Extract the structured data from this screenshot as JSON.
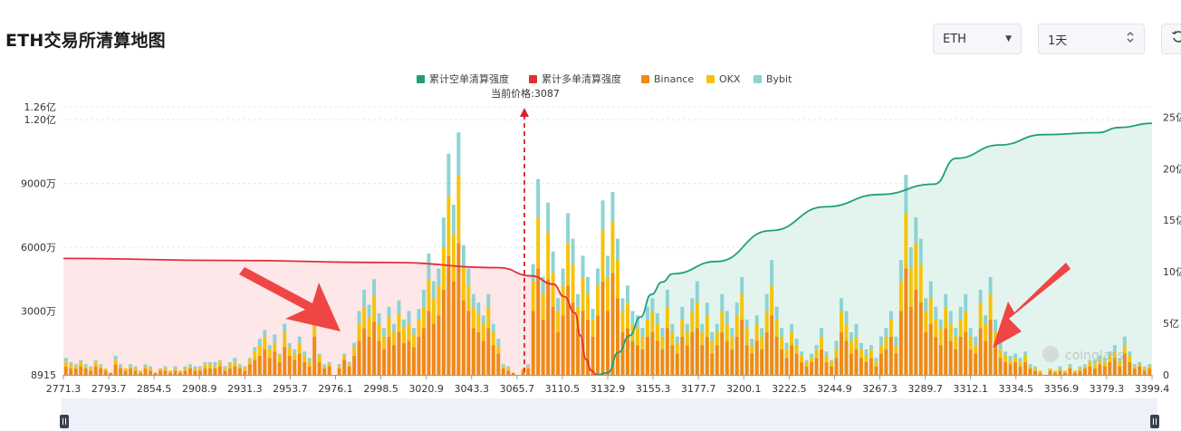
{
  "title": "ETH交易所清算地图",
  "controls": {
    "symbol": "ETH",
    "period": "1天"
  },
  "watermark": "coinglass",
  "chart_data": {
    "type": "bar",
    "title": "ETH交易所清算地图",
    "current_price_label": "当前价格:3087",
    "current_price": 3087,
    "legend": [
      {
        "name": "累计空单清算强度",
        "color": "#1f9e7f"
      },
      {
        "name": "累计多单清算强度",
        "color": "#e0303a"
      },
      {
        "name": "Binance",
        "color": "#ef8a17"
      },
      {
        "name": "OKX",
        "color": "#f5c30b"
      },
      {
        "name": "Bybit",
        "color": "#8dd3d4"
      }
    ],
    "legend_position": "top-center",
    "x_tick_labels": [
      "2771.3",
      "2793.7",
      "2854.5",
      "2908.9",
      "2931.3",
      "2953.7",
      "2976.1",
      "2998.5",
      "3020.9",
      "3043.3",
      "3065.7",
      "3110.5",
      "3132.9",
      "3155.3",
      "3177.7",
      "3200.1",
      "3222.5",
      "3244.9",
      "3267.3",
      "3289.7",
      "3312.1",
      "3334.5",
      "3356.9",
      "3379.3",
      "3399.4"
    ],
    "y_left_tick_labels": [
      "8915",
      "3000万",
      "6000万",
      "9000万",
      "1.20亿",
      "1.26亿"
    ],
    "y_left_ticks": [
      0,
      30000000,
      60000000,
      90000000,
      120000000,
      126000000
    ],
    "y_left_range": [
      0,
      126000000
    ],
    "y_right_tick_labels": [
      "0",
      "5亿",
      "10亿",
      "15亿",
      "20亿",
      "25亿"
    ],
    "y_right_ticks": [
      0,
      500000000,
      1000000000,
      1500000000,
      2000000000,
      2500000000
    ],
    "y_right_range": [
      0,
      2600000000
    ],
    "grid": true,
    "bar_stack": [
      [
        4,
        2,
        2
      ],
      [
        3,
        2,
        1
      ],
      [
        3,
        1,
        1
      ],
      [
        4,
        2,
        1
      ],
      [
        3,
        1,
        1
      ],
      [
        2,
        1,
        1
      ],
      [
        4,
        2,
        1
      ],
      [
        3,
        1,
        1
      ],
      [
        2,
        1,
        0
      ],
      [
        1,
        0,
        0
      ],
      [
        5,
        2,
        2
      ],
      [
        3,
        1,
        1
      ],
      [
        2,
        1,
        0
      ],
      [
        3,
        1,
        1
      ],
      [
        2,
        1,
        1
      ],
      [
        1,
        1,
        0
      ],
      [
        3,
        1,
        1
      ],
      [
        2,
        1,
        1
      ],
      [
        1,
        0,
        0
      ],
      [
        2,
        1,
        0
      ],
      [
        2,
        1,
        1
      ],
      [
        1,
        1,
        0
      ],
      [
        2,
        1,
        1
      ],
      [
        1,
        1,
        0
      ],
      [
        2,
        1,
        1
      ],
      [
        3,
        1,
        1
      ],
      [
        2,
        1,
        1
      ],
      [
        2,
        1,
        1
      ],
      [
        3,
        2,
        1
      ],
      [
        3,
        2,
        1
      ],
      [
        3,
        1,
        2
      ],
      [
        4,
        2,
        1
      ],
      [
        2,
        1,
        1
      ],
      [
        3,
        2,
        1
      ],
      [
        4,
        2,
        2
      ],
      [
        3,
        1,
        1
      ],
      [
        2,
        1,
        1
      ],
      [
        5,
        2,
        1
      ],
      [
        7,
        4,
        2
      ],
      [
        9,
        5,
        3
      ],
      [
        12,
        6,
        3
      ],
      [
        8,
        4,
        2
      ],
      [
        11,
        4,
        4
      ],
      [
        6,
        3,
        1
      ],
      [
        13,
        7,
        4
      ],
      [
        9,
        4,
        2
      ],
      [
        7,
        3,
        2
      ],
      [
        10,
        5,
        3
      ],
      [
        6,
        3,
        2
      ],
      [
        4,
        2,
        2
      ],
      [
        18,
        8,
        5
      ],
      [
        6,
        3,
        1
      ],
      [
        3,
        1,
        1
      ],
      [
        4,
        1,
        1
      ],
      [
        0,
        0,
        0
      ],
      [
        3,
        1,
        1
      ],
      [
        7,
        2,
        1
      ],
      [
        4,
        1,
        1
      ],
      [
        9,
        4,
        2
      ],
      [
        16,
        8,
        6
      ],
      [
        22,
        10,
        8
      ],
      [
        18,
        9,
        6
      ],
      [
        25,
        12,
        8
      ],
      [
        16,
        8,
        5
      ],
      [
        12,
        6,
        4
      ],
      [
        18,
        9,
        5
      ],
      [
        14,
        6,
        4
      ],
      [
        20,
        9,
        6
      ],
      [
        15,
        7,
        4
      ],
      [
        16,
        8,
        6
      ],
      [
        13,
        6,
        3
      ],
      [
        18,
        8,
        5
      ],
      [
        22,
        10,
        8
      ],
      [
        30,
        15,
        12
      ],
      [
        24,
        12,
        8
      ],
      [
        28,
        14,
        8
      ],
      [
        40,
        20,
        14
      ],
      [
        56,
        28,
        20
      ],
      [
        44,
        22,
        14
      ],
      [
        62,
        32,
        20
      ],
      [
        35,
        16,
        10
      ],
      [
        30,
        12,
        8
      ],
      [
        22,
        10,
        6
      ],
      [
        20,
        9,
        5
      ],
      [
        16,
        8,
        4
      ],
      [
        22,
        10,
        6
      ],
      [
        14,
        6,
        4
      ],
      [
        10,
        4,
        3
      ],
      [
        3,
        1,
        1
      ],
      [
        2,
        1,
        1
      ],
      [
        1,
        0,
        0
      ],
      [
        0,
        0,
        0
      ],
      [
        2,
        1,
        0
      ],
      [
        3,
        1,
        1
      ],
      [
        30,
        14,
        8
      ],
      [
        50,
        24,
        18
      ],
      [
        26,
        12,
        8
      ],
      [
        45,
        22,
        14
      ],
      [
        32,
        16,
        10
      ],
      [
        20,
        10,
        6
      ],
      [
        28,
        14,
        8
      ],
      [
        42,
        20,
        14
      ],
      [
        34,
        18,
        12
      ],
      [
        22,
        10,
        6
      ],
      [
        30,
        16,
        10
      ],
      [
        26,
        12,
        8
      ],
      [
        18,
        8,
        5
      ],
      [
        28,
        14,
        8
      ],
      [
        44,
        24,
        14
      ],
      [
        30,
        16,
        10
      ],
      [
        48,
        24,
        14
      ],
      [
        36,
        18,
        10
      ],
      [
        20,
        10,
        6
      ],
      [
        22,
        12,
        8
      ],
      [
        16,
        8,
        6
      ],
      [
        14,
        8,
        6
      ],
      [
        12,
        6,
        4
      ],
      [
        18,
        8,
        6
      ],
      [
        20,
        10,
        6
      ],
      [
        16,
        8,
        5
      ],
      [
        12,
        6,
        4
      ],
      [
        22,
        10,
        8
      ],
      [
        14,
        6,
        4
      ],
      [
        10,
        5,
        3
      ],
      [
        18,
        8,
        6
      ],
      [
        14,
        6,
        4
      ],
      [
        20,
        10,
        6
      ],
      [
        22,
        12,
        10
      ],
      [
        14,
        6,
        4
      ],
      [
        18,
        10,
        6
      ],
      [
        10,
        6,
        4
      ],
      [
        14,
        6,
        4
      ],
      [
        20,
        10,
        8
      ],
      [
        16,
        8,
        6
      ],
      [
        12,
        6,
        4
      ],
      [
        18,
        10,
        6
      ],
      [
        26,
        12,
        8
      ],
      [
        14,
        8,
        4
      ],
      [
        10,
        4,
        3
      ],
      [
        16,
        8,
        4
      ],
      [
        12,
        6,
        4
      ],
      [
        20,
        10,
        8
      ],
      [
        28,
        14,
        12
      ],
      [
        18,
        8,
        6
      ],
      [
        12,
        6,
        4
      ],
      [
        8,
        4,
        3
      ],
      [
        14,
        6,
        4
      ],
      [
        10,
        4,
        3
      ],
      [
        6,
        3,
        2
      ],
      [
        4,
        2,
        1
      ],
      [
        6,
        2,
        2
      ],
      [
        8,
        4,
        2
      ],
      [
        12,
        6,
        4
      ],
      [
        6,
        3,
        2
      ],
      [
        4,
        2,
        1
      ],
      [
        8,
        4,
        4
      ],
      [
        20,
        10,
        6
      ],
      [
        16,
        8,
        6
      ],
      [
        10,
        6,
        4
      ],
      [
        12,
        6,
        6
      ],
      [
        8,
        4,
        3
      ],
      [
        6,
        3,
        3
      ],
      [
        8,
        4,
        2
      ],
      [
        4,
        2,
        2
      ],
      [
        10,
        4,
        4
      ],
      [
        12,
        6,
        4
      ],
      [
        18,
        8,
        4
      ],
      [
        10,
        4,
        4
      ],
      [
        30,
        14,
        10
      ],
      [
        50,
        26,
        18
      ],
      [
        32,
        18,
        10
      ],
      [
        40,
        22,
        12
      ],
      [
        34,
        18,
        12
      ],
      [
        20,
        10,
        6
      ],
      [
        24,
        12,
        8
      ],
      [
        18,
        8,
        6
      ],
      [
        14,
        8,
        4
      ],
      [
        22,
        10,
        6
      ],
      [
        16,
        8,
        6
      ],
      [
        12,
        6,
        4
      ],
      [
        18,
        8,
        6
      ],
      [
        20,
        10,
        8
      ],
      [
        12,
        6,
        4
      ],
      [
        10,
        4,
        4
      ],
      [
        22,
        12,
        6
      ],
      [
        16,
        8,
        4
      ],
      [
        26,
        12,
        8
      ],
      [
        14,
        6,
        6
      ],
      [
        8,
        4,
        3
      ],
      [
        6,
        3,
        2
      ],
      [
        5,
        2,
        2
      ],
      [
        6,
        2,
        2
      ],
      [
        4,
        2,
        2
      ],
      [
        6,
        3,
        2
      ],
      [
        3,
        1,
        1
      ],
      [
        2,
        1,
        1
      ],
      [
        1,
        1,
        0
      ],
      [
        0,
        0,
        0
      ],
      [
        2,
        1,
        0
      ],
      [
        1,
        1,
        0
      ],
      [
        2,
        1,
        1
      ],
      [
        1,
        1,
        0
      ],
      [
        3,
        1,
        1
      ],
      [
        1,
        1,
        0
      ],
      [
        2,
        1,
        1
      ],
      [
        3,
        1,
        1
      ],
      [
        4,
        2,
        1
      ],
      [
        3,
        2,
        2
      ],
      [
        5,
        2,
        2
      ],
      [
        4,
        2,
        2
      ],
      [
        6,
        3,
        2
      ],
      [
        8,
        3,
        3
      ],
      [
        4,
        2,
        2
      ],
      [
        10,
        4,
        4
      ],
      [
        6,
        3,
        2
      ],
      [
        3,
        1,
        1
      ],
      [
        4,
        1,
        1
      ],
      [
        2,
        1,
        1
      ],
      [
        3,
        1,
        1
      ]
    ],
    "bar_stack_units": "millions",
    "long_cumulative": [
      [
        0,
        1130000000
      ],
      [
        0.15,
        1110000000
      ],
      [
        0.3,
        1090000000
      ],
      [
        0.4,
        1040000000
      ],
      [
        0.43,
        960000000
      ],
      [
        0.45,
        880000000
      ],
      [
        0.46,
        760000000
      ],
      [
        0.47,
        600000000
      ],
      [
        0.475,
        380000000
      ],
      [
        0.48,
        150000000
      ],
      [
        0.485,
        40000000
      ],
      [
        0.49,
        0
      ]
    ],
    "short_cumulative": [
      [
        0.49,
        0
      ],
      [
        0.5,
        20000000
      ],
      [
        0.51,
        220000000
      ],
      [
        0.52,
        380000000
      ],
      [
        0.53,
        560000000
      ],
      [
        0.54,
        780000000
      ],
      [
        0.55,
        900000000
      ],
      [
        0.56,
        980000000
      ],
      [
        0.6,
        1100000000
      ],
      [
        0.65,
        1400000000
      ],
      [
        0.7,
        1630000000
      ],
      [
        0.75,
        1750000000
      ],
      [
        0.8,
        1850000000
      ],
      [
        0.82,
        2100000000
      ],
      [
        0.86,
        2230000000
      ],
      [
        0.9,
        2330000000
      ],
      [
        0.95,
        2350000000
      ],
      [
        0.97,
        2400000000
      ],
      [
        1.0,
        2440000000
      ]
    ]
  }
}
